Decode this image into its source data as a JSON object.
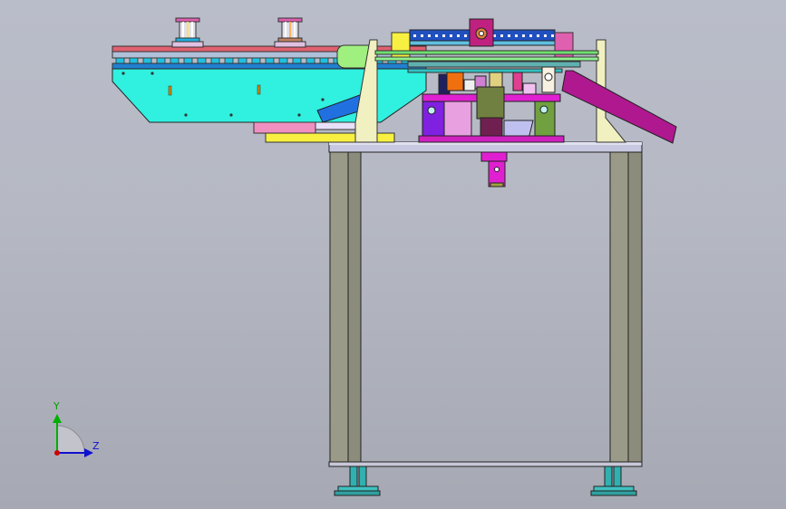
{
  "view": {
    "background_top": "#b9bdc9",
    "background_bottom": "#a6a9b3"
  },
  "triad": {
    "y_label": "Y",
    "z_label": "Z",
    "y_color": "#00b000",
    "z_color": "#1010d0",
    "x_color": "#d00000"
  },
  "model": {
    "frame_color": "#9a9a88",
    "table_top_color": "#c8c8e0",
    "feeder_body_color": "#30f0e0",
    "feeder_rail_color": "#b0c0d8",
    "accent_magenta": "#e020d0",
    "accent_yellow": "#f8f040",
    "chute_color": "#b01890",
    "foot_color": "#30b0b0"
  }
}
